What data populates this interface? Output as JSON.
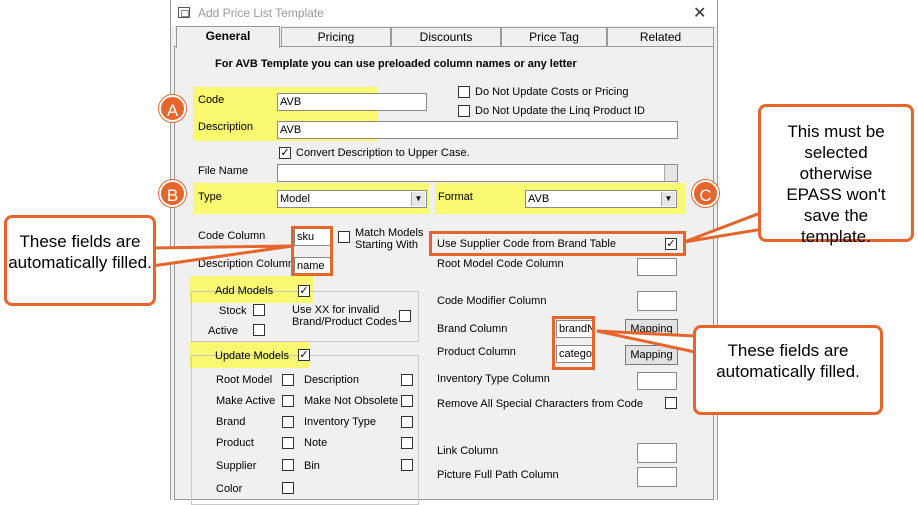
{
  "window": {
    "title": "Add Price List Template",
    "close_glyph": "✕"
  },
  "tabs": [
    {
      "label": "General",
      "active": true
    },
    {
      "label": "Pricing"
    },
    {
      "label": "Discounts"
    },
    {
      "label": "Price Tag"
    },
    {
      "label": "Related"
    }
  ],
  "header_note": "For AVB Template you can use preloaded column names or any letter",
  "form": {
    "code_label": "Code",
    "code_value": "AVB",
    "description_label": "Description",
    "description_value": "AVB",
    "dont_update_costs_label": "Do Not Update Costs or Pricing",
    "dont_update_linq_label": "Do Not Update the Linq Product ID",
    "convert_upper_label": "Convert Description to Upper Case.",
    "convert_upper_checked": true,
    "file_name_label": "File Name",
    "file_name_value": "",
    "type_label": "Type",
    "type_value": "Model",
    "format_label": "Format",
    "format_value": "AVB",
    "code_column_label": "Code Column",
    "code_column_value": "sku",
    "match_models_label_1": "Match Models",
    "match_models_label_2": "Starting With",
    "description_column_label": "Description Column",
    "description_column_value": "name",
    "use_supplier_code_label": "Use Supplier Code from Brand Table",
    "use_supplier_code_checked": true,
    "root_model_code_column_label": "Root Model Code Column",
    "code_modifier_column_label": "Code Modifier Column",
    "brand_column_label": "Brand Column",
    "brand_column_value": "brandN",
    "product_column_label": "Product Column",
    "product_column_value": "categor",
    "mapping_label": "Mapping",
    "inventory_type_column_label": "Inventory Type Column",
    "remove_special_chars_label": "Remove All Special Characters from Code",
    "link_column_label": "Link Column",
    "picture_full_path_label": "Picture Full Path Column",
    "add_models": {
      "label": "Add Models",
      "checked": true,
      "stock_label": "Stock",
      "active_label": "Active",
      "use_xx_label_1": "Use XX for invalid",
      "use_xx_label_2": "Brand/Product Codes"
    },
    "update_models": {
      "label": "Update Models",
      "checked": true,
      "left": [
        "Root Model",
        "Make Active",
        "Brand",
        "Product",
        "Supplier",
        "Color"
      ],
      "right": [
        "Description",
        "Make Not Obsolete",
        "Inventory Type",
        "Note",
        "Bin"
      ]
    }
  },
  "annotations": {
    "badge_a": "A",
    "badge_b": "B",
    "badge_c": "C",
    "left_callout": "These fields are automatically filled.",
    "right_callout": "These fields are automatically filled.",
    "top_right_callout": "This must be selected otherwise EPASS won't save the template."
  },
  "colors": {
    "highlight": "#f9f871",
    "annotation": "#e5652b"
  }
}
